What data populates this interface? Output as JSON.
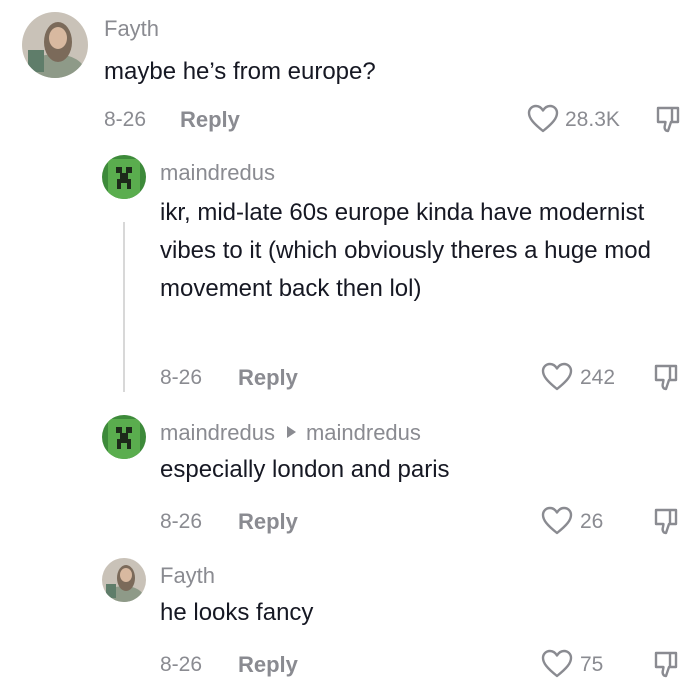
{
  "comments": [
    {
      "author": "Fayth",
      "text": "maybe he’s from europe?",
      "date": "8-26",
      "reply_label": "Reply",
      "likes": "28.3K",
      "avatar_icon": "user-avatar-photo"
    },
    {
      "author": "maindredus",
      "text": "ikr, mid-late 60s europe kinda have modernist vibes to it (which obviously theres a huge mod movement back then lol)",
      "date": "8-26",
      "reply_label": "Reply",
      "likes": "242",
      "avatar_icon": "creeper-avatar"
    },
    {
      "author": "maindredus",
      "reply_to": "maindredus",
      "text": "especially london and paris",
      "date": "8-26",
      "reply_label": "Reply",
      "likes": "26",
      "avatar_icon": "creeper-avatar"
    },
    {
      "author": "Fayth",
      "text": "he looks fancy",
      "date": "8-26",
      "reply_label": "Reply",
      "likes": "75",
      "avatar_icon": "user-avatar-photo"
    }
  ],
  "icons": {
    "like": "heart-icon",
    "dislike": "thumbs-down-icon",
    "reply_arrow": "caret-right-icon"
  },
  "colors": {
    "text": "#161823",
    "secondary": "#8a8b91",
    "thread_line": "#d8d8d8"
  }
}
